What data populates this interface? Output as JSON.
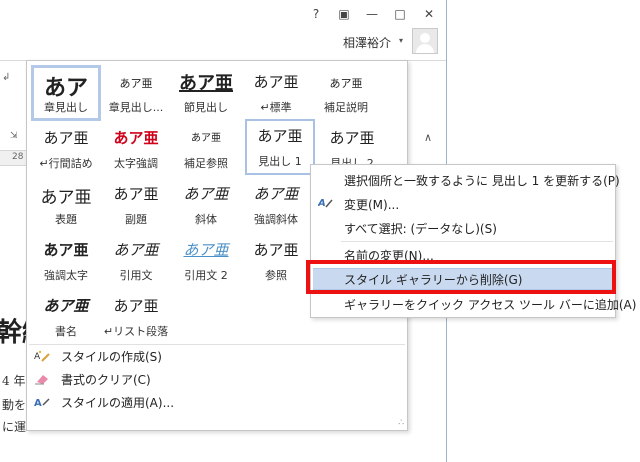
{
  "window": {
    "help_label": "?",
    "ribbon_display_label": "▣",
    "minimize_label": "—",
    "maximize_label": "□",
    "close_label": "✕",
    "user_name": "相澤裕介",
    "user_arrow": "▾",
    "ruler_number": "28",
    "collapse_label": "∧",
    "ribbon_mark": "↲",
    "launcher_mark": "⇲"
  },
  "document": {
    "heading_fragment": "幹縦",
    "line1": "4 年",
    "line2": "動を",
    "line3": "に運"
  },
  "gallery": {
    "styles": [
      {
        "preview": "あア",
        "label": "章見出し"
      },
      {
        "preview": "あア亜",
        "label": "章見出し..."
      },
      {
        "preview": "あア亜",
        "label": "節見出し"
      },
      {
        "preview": "あア亜",
        "label": "↵標準"
      },
      {
        "preview": "あア亜",
        "label": "補足説明"
      },
      {
        "preview": "あア亜",
        "label": "↵行間詰め"
      },
      {
        "preview": "あア亜",
        "label": "太字強調"
      },
      {
        "preview": "あア亜",
        "label": "補足参照"
      },
      {
        "preview": "あア亜",
        "label": "見出し 1"
      },
      {
        "preview": "あア亜",
        "label": "見出し 2"
      },
      {
        "preview": "あア亜",
        "label": "表題"
      },
      {
        "preview": "あア亜",
        "label": "副題"
      },
      {
        "preview": "あア亜",
        "label": "斜体"
      },
      {
        "preview": "あア亜",
        "label": "強調斜体"
      },
      {
        "preview": "あア亜",
        "label": "強調太字"
      },
      {
        "preview": "あア亜",
        "label": "引用文"
      },
      {
        "preview": "あア亜",
        "label": "引用文 2"
      },
      {
        "preview": "あア亜",
        "label": "参照"
      },
      {
        "preview": "あア亜",
        "label": "書名"
      },
      {
        "preview": "あア亜",
        "label": "↵リスト段落"
      }
    ],
    "commands": {
      "create_style": "スタイルの作成(S)",
      "clear_formatting": "書式のクリア(C)",
      "apply_styles": "スタイルの適用(A)..."
    },
    "grip": "∴"
  },
  "context_menu": {
    "items": [
      {
        "label": "選択個所と一致するように 見出し 1 を更新する(P)"
      },
      {
        "label": "変更(M)..."
      },
      {
        "label": "すべて選択: (データなし)(S)"
      },
      {
        "label": "名前の変更(N)..."
      },
      {
        "label": "スタイル ギャラリーから削除(G)"
      },
      {
        "label": "ギャラリーをクイック アクセス ツール バーに追加(A)"
      }
    ]
  }
}
